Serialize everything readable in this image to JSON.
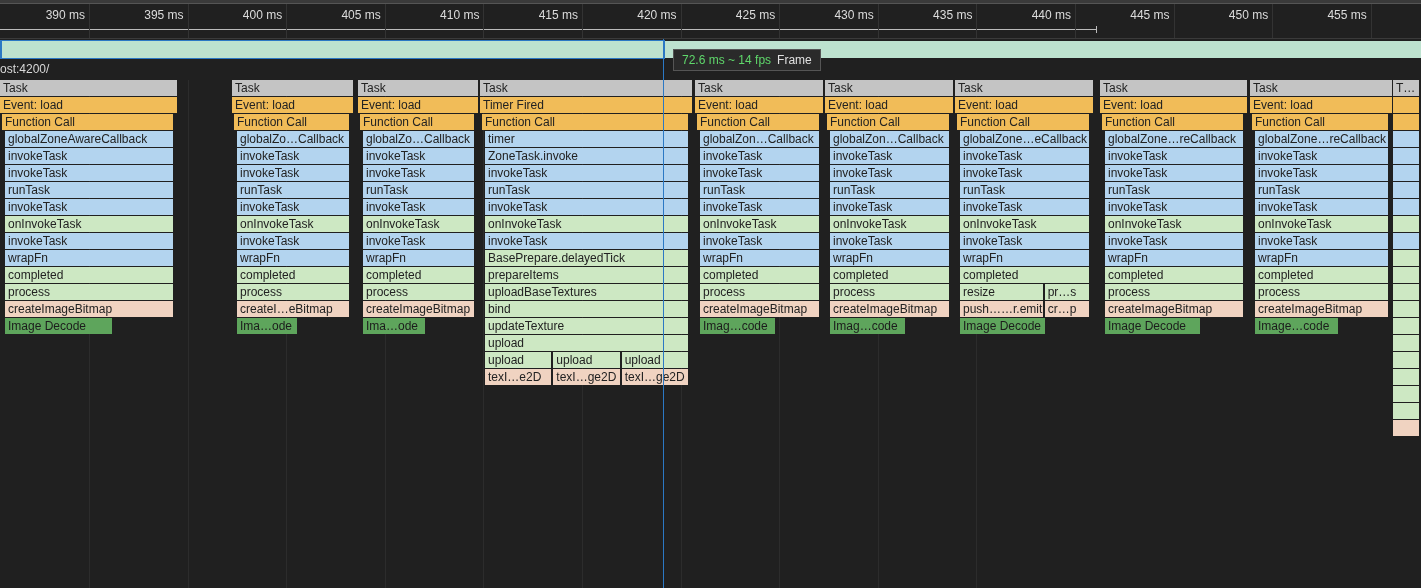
{
  "ruler": {
    "ticks": [
      "390 ms",
      "395 ms",
      "400 ms",
      "405 ms",
      "410 ms",
      "415 ms",
      "420 ms",
      "425 ms",
      "430 ms",
      "435 ms",
      "440 ms",
      "445 ms",
      "450 ms",
      "455 ms"
    ]
  },
  "frames": {
    "tooltip": {
      "duration": "72.6 ms ~ 14 fps",
      "name": "Frame"
    }
  },
  "track": {
    "label": "ost:4200/"
  },
  "tasks": [
    {
      "label": "Task",
      "rows": [
        {
          "label": "Event: load",
          "kind": "event"
        },
        {
          "label": "Function Call",
          "kind": "event"
        },
        {
          "label": "globalZoneAwareCallback",
          "kind": "js"
        },
        {
          "label": "invokeTask",
          "kind": "js"
        },
        {
          "label": "invokeTask",
          "kind": "js"
        },
        {
          "label": "runTask",
          "kind": "js"
        },
        {
          "label": "invokeTask",
          "kind": "js"
        },
        {
          "label": "onInvokeTask",
          "kind": "js2"
        },
        {
          "label": "invokeTask",
          "kind": "js"
        },
        {
          "label": "wrapFn",
          "kind": "js"
        },
        {
          "label": "completed",
          "kind": "js2"
        },
        {
          "label": "process",
          "kind": "js2"
        },
        {
          "label": "createImageBitmap",
          "kind": "native"
        },
        {
          "label": "Image Decode",
          "kind": "decode"
        }
      ]
    },
    {
      "label": "Task",
      "rows": [
        {
          "label": "Event: load",
          "kind": "event"
        },
        {
          "label": "Function Call",
          "kind": "event"
        },
        {
          "label": "globalZo…Callback",
          "kind": "js"
        },
        {
          "label": "invokeTask",
          "kind": "js"
        },
        {
          "label": "invokeTask",
          "kind": "js"
        },
        {
          "label": "runTask",
          "kind": "js"
        },
        {
          "label": "invokeTask",
          "kind": "js"
        },
        {
          "label": "onInvokeTask",
          "kind": "js2"
        },
        {
          "label": "invokeTask",
          "kind": "js"
        },
        {
          "label": "wrapFn",
          "kind": "js"
        },
        {
          "label": "completed",
          "kind": "js2"
        },
        {
          "label": "process",
          "kind": "js2"
        },
        {
          "label": "createI…eBitmap",
          "kind": "native"
        },
        {
          "label": "Ima…ode",
          "kind": "decode"
        }
      ]
    },
    {
      "label": "Task",
      "rows": [
        {
          "label": "Event: load",
          "kind": "event"
        },
        {
          "label": "Function Call",
          "kind": "event"
        },
        {
          "label": "globalZo…Callback",
          "kind": "js"
        },
        {
          "label": "invokeTask",
          "kind": "js"
        },
        {
          "label": "invokeTask",
          "kind": "js"
        },
        {
          "label": "runTask",
          "kind": "js"
        },
        {
          "label": "invokeTask",
          "kind": "js"
        },
        {
          "label": "onInvokeTask",
          "kind": "js2"
        },
        {
          "label": "invokeTask",
          "kind": "js"
        },
        {
          "label": "wrapFn",
          "kind": "js"
        },
        {
          "label": "completed",
          "kind": "js2"
        },
        {
          "label": "process",
          "kind": "js2"
        },
        {
          "label": "createImageBitmap",
          "kind": "native"
        },
        {
          "label": "Ima…ode",
          "kind": "decode"
        }
      ]
    },
    {
      "label": "Task",
      "rows": [
        {
          "label": "Timer Fired",
          "kind": "event"
        },
        {
          "label": "Function Call",
          "kind": "event"
        },
        {
          "label": "timer",
          "kind": "js"
        },
        {
          "label": "ZoneTask.invoke",
          "kind": "js"
        },
        {
          "label": "invokeTask",
          "kind": "js"
        },
        {
          "label": "runTask",
          "kind": "js"
        },
        {
          "label": "invokeTask",
          "kind": "js"
        },
        {
          "label": "onInvokeTask",
          "kind": "js2"
        },
        {
          "label": "invokeTask",
          "kind": "js"
        },
        {
          "label": "BasePrepare.delayedTick",
          "kind": "js2"
        },
        {
          "label": "prepareItems",
          "kind": "js2"
        },
        {
          "label": "uploadBaseTextures",
          "kind": "js2"
        },
        {
          "label": "bind",
          "kind": "js2"
        },
        {
          "label": "updateTexture",
          "kind": "js2"
        },
        {
          "label": "upload",
          "kind": "js2"
        },
        {
          "kind": "split",
          "parts": [
            {
              "label": "upload",
              "kind": "js2"
            },
            {
              "label": "upload",
              "kind": "js2"
            },
            {
              "label": "upload",
              "kind": "js2"
            }
          ]
        },
        {
          "kind": "split",
          "parts": [
            {
              "label": "texI…e2D",
              "kind": "native"
            },
            {
              "label": "texI…ge2D",
              "kind": "native"
            },
            {
              "label": "texI…ge2D",
              "kind": "native"
            }
          ]
        }
      ]
    },
    {
      "label": "Task",
      "rows": [
        {
          "label": "Event: load",
          "kind": "event"
        },
        {
          "label": "Function Call",
          "kind": "event"
        },
        {
          "label": "globalZon…Callback",
          "kind": "js"
        },
        {
          "label": "invokeTask",
          "kind": "js"
        },
        {
          "label": "invokeTask",
          "kind": "js"
        },
        {
          "label": "runTask",
          "kind": "js"
        },
        {
          "label": "invokeTask",
          "kind": "js"
        },
        {
          "label": "onInvokeTask",
          "kind": "js2"
        },
        {
          "label": "invokeTask",
          "kind": "js"
        },
        {
          "label": "wrapFn",
          "kind": "js"
        },
        {
          "label": "completed",
          "kind": "js2"
        },
        {
          "label": "process",
          "kind": "js2"
        },
        {
          "label": "createImageBitmap",
          "kind": "native"
        },
        {
          "label": "Imag…code",
          "kind": "decode"
        }
      ]
    },
    {
      "label": "Task",
      "rows": [
        {
          "label": "Event: load",
          "kind": "event"
        },
        {
          "label": "Function Call",
          "kind": "event"
        },
        {
          "label": "globalZon…Callback",
          "kind": "js"
        },
        {
          "label": "invokeTask",
          "kind": "js"
        },
        {
          "label": "invokeTask",
          "kind": "js"
        },
        {
          "label": "runTask",
          "kind": "js"
        },
        {
          "label": "invokeTask",
          "kind": "js"
        },
        {
          "label": "onInvokeTask",
          "kind": "js2"
        },
        {
          "label": "invokeTask",
          "kind": "js"
        },
        {
          "label": "wrapFn",
          "kind": "js"
        },
        {
          "label": "completed",
          "kind": "js2"
        },
        {
          "label": "process",
          "kind": "js2"
        },
        {
          "label": "createImageBitmap",
          "kind": "native"
        },
        {
          "label": "Imag…code",
          "kind": "decode"
        }
      ]
    },
    {
      "label": "Task",
      "rows": [
        {
          "label": "Event: load",
          "kind": "event"
        },
        {
          "label": "Function Call",
          "kind": "event"
        },
        {
          "label": "globalZone…eCallback",
          "kind": "js"
        },
        {
          "label": "invokeTask",
          "kind": "js"
        },
        {
          "label": "invokeTask",
          "kind": "js"
        },
        {
          "label": "runTask",
          "kind": "js"
        },
        {
          "label": "invokeTask",
          "kind": "js"
        },
        {
          "label": "onInvokeTask",
          "kind": "js2"
        },
        {
          "label": "invokeTask",
          "kind": "js"
        },
        {
          "label": "wrapFn",
          "kind": "js"
        },
        {
          "label": "completed",
          "kind": "js2"
        },
        {
          "kind": "split",
          "parts": [
            {
              "label": "resize",
              "kind": "js2"
            },
            {
              "label": "pr…s",
              "kind": "js2"
            }
          ]
        },
        {
          "kind": "split",
          "parts": [
            {
              "label": "push……r.emit",
              "kind": "native"
            },
            {
              "label": "cr…p",
              "kind": "native"
            }
          ]
        },
        {
          "label": "Image Decode",
          "kind": "decode"
        }
      ]
    },
    {
      "label": "Task",
      "rows": [
        {
          "label": "Event: load",
          "kind": "event"
        },
        {
          "label": "Function Call",
          "kind": "event"
        },
        {
          "label": "globalZone…reCallback",
          "kind": "js"
        },
        {
          "label": "invokeTask",
          "kind": "js"
        },
        {
          "label": "invokeTask",
          "kind": "js"
        },
        {
          "label": "runTask",
          "kind": "js"
        },
        {
          "label": "invokeTask",
          "kind": "js"
        },
        {
          "label": "onInvokeTask",
          "kind": "js2"
        },
        {
          "label": "invokeTask",
          "kind": "js"
        },
        {
          "label": "wrapFn",
          "kind": "js"
        },
        {
          "label": "completed",
          "kind": "js2"
        },
        {
          "label": "process",
          "kind": "js2"
        },
        {
          "label": "createImageBitmap",
          "kind": "native"
        },
        {
          "label": "Image Decode",
          "kind": "decode"
        }
      ]
    },
    {
      "label": "Task",
      "rows": [
        {
          "label": "Event: load",
          "kind": "event"
        },
        {
          "label": "Function Call",
          "kind": "event"
        },
        {
          "label": "globalZone…reCallback",
          "kind": "js"
        },
        {
          "label": "invokeTask",
          "kind": "js"
        },
        {
          "label": "invokeTask",
          "kind": "js"
        },
        {
          "label": "runTask",
          "kind": "js"
        },
        {
          "label": "invokeTask",
          "kind": "js"
        },
        {
          "label": "onInvokeTask",
          "kind": "js2"
        },
        {
          "label": "invokeTask",
          "kind": "js"
        },
        {
          "label": "wrapFn",
          "kind": "js"
        },
        {
          "label": "completed",
          "kind": "js2"
        },
        {
          "label": "process",
          "kind": "js2"
        },
        {
          "label": "createImageBitmap",
          "kind": "native"
        },
        {
          "label": "Image…code",
          "kind": "decode"
        }
      ]
    },
    {
      "label": "T…",
      "rows": [
        {
          "kind": "event"
        },
        {
          "kind": "event"
        },
        {
          "kind": "js"
        },
        {
          "kind": "js"
        },
        {
          "kind": "js"
        },
        {
          "kind": "js"
        },
        {
          "kind": "js"
        },
        {
          "kind": "js2"
        },
        {
          "kind": "js"
        },
        {
          "kind": "js2"
        },
        {
          "kind": "js2"
        },
        {
          "kind": "js2"
        },
        {
          "kind": "js2"
        },
        {
          "kind": "js2"
        },
        {
          "kind": "js2"
        },
        {
          "kind": "js2"
        },
        {
          "kind": "js2"
        },
        {
          "kind": "js2"
        },
        {
          "kind": "js2"
        },
        {
          "kind": "native"
        }
      ]
    }
  ]
}
